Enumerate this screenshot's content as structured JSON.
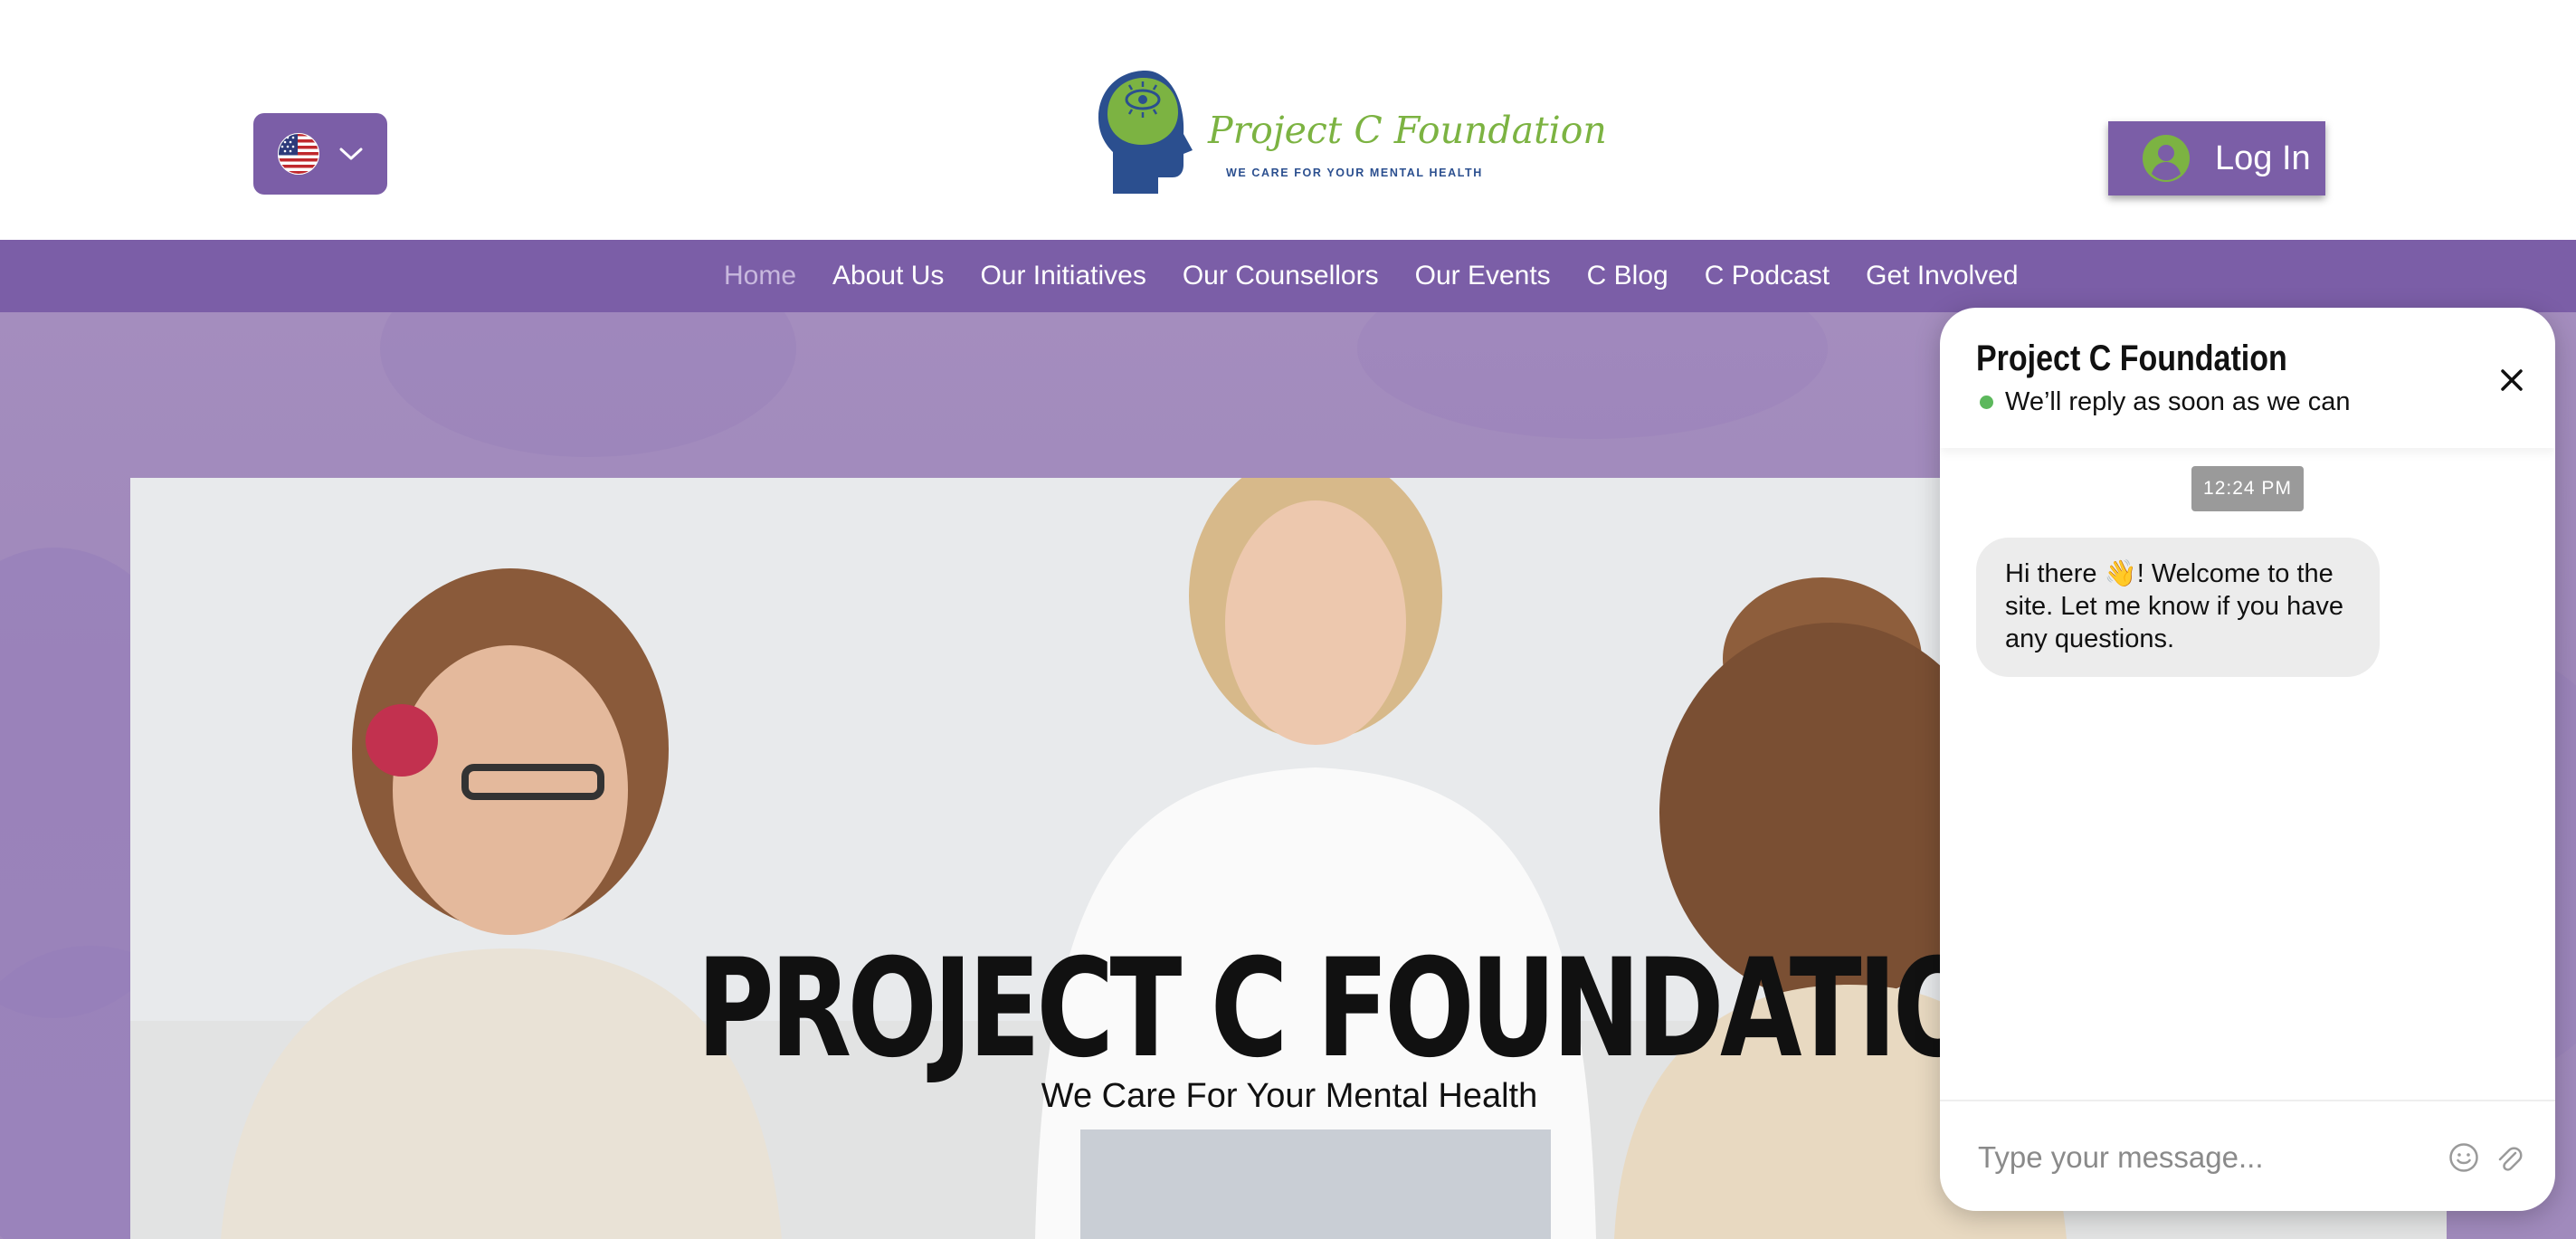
{
  "header": {
    "language_selector": {
      "flag": "us-flag-icon",
      "chevron": "chevron-down-icon"
    },
    "logo": {
      "name": "Project C Foundation",
      "tagline": "WE CARE FOR YOUR MENTAL HEALTH"
    },
    "login": {
      "label": "Log In",
      "icon": "user-avatar-icon"
    }
  },
  "nav": {
    "items": [
      {
        "label": "Home",
        "active": true
      },
      {
        "label": "About Us"
      },
      {
        "label": "Our Initiatives"
      },
      {
        "label": "Our Counsellors"
      },
      {
        "label": "Our Events"
      },
      {
        "label": "C Blog"
      },
      {
        "label": "C Podcast"
      },
      {
        "label": "Get Involved"
      }
    ]
  },
  "hero": {
    "title": "PROJECT C FOUNDATION",
    "subtitle": "We Care For Your Mental Health"
  },
  "chat": {
    "title": "Project C Foundation",
    "status": "We’ll reply as soon as we can",
    "time": "12:24 PM",
    "message": "Hi there 👋! Welcome to the site. Let me know if you have any questions.",
    "input_placeholder": "Type your message...",
    "icons": [
      "close-icon",
      "emoji-icon",
      "attachment-icon"
    ]
  },
  "colors": {
    "brand_purple": "#7b5ea7",
    "nav_active": "#c8b8de",
    "logo_green": "#7cb342",
    "logo_blue": "#2b4f8f",
    "status_green": "#5cb85c"
  }
}
